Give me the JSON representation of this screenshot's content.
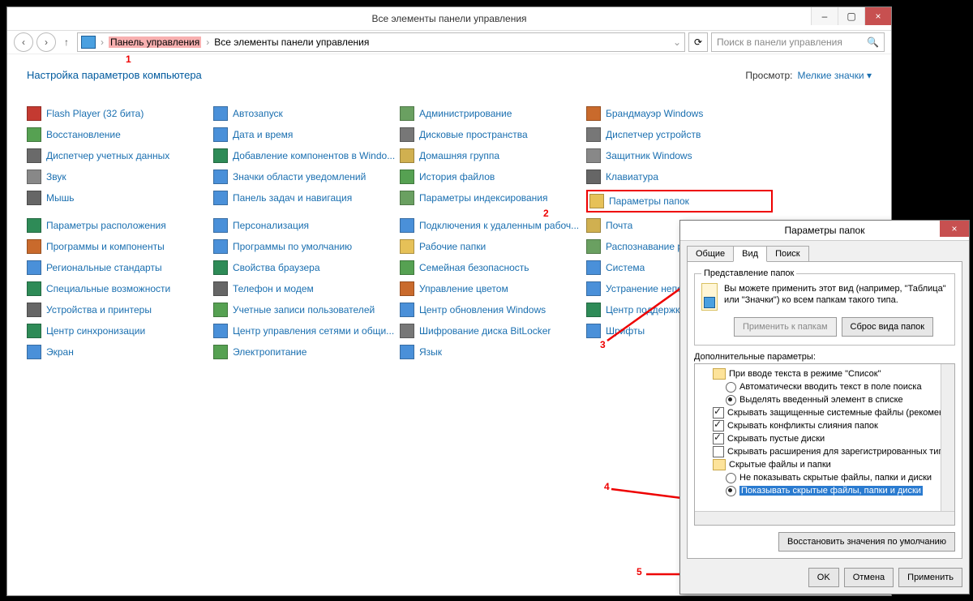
{
  "window": {
    "title": "Все элементы панели управления",
    "minimize": "–",
    "maximize": "▢",
    "close": "×"
  },
  "nav": {
    "back": "‹",
    "forward": "›",
    "up": "↑",
    "bc1": "Панель управления",
    "bc2": "Все элементы панели управления",
    "refresh": "⟳",
    "search_ph": "Поиск в панели управления",
    "mag": "🔍"
  },
  "header": {
    "h": "Настройка параметров компьютера",
    "view_label": "Просмотр:",
    "view_value": "Мелкие значки ▾"
  },
  "items": [
    {
      "t": "Flash Player (32 бита)",
      "c": "#c43a31",
      "hl": false
    },
    {
      "t": "Автозапуск",
      "c": "#4a90d9",
      "hl": false
    },
    {
      "t": "Администрирование",
      "c": "#6aa061",
      "hl": false
    },
    {
      "t": "Брандмауэр Windows",
      "c": "#c96a2c",
      "hl": false
    },
    {
      "t": "Восстановление",
      "c": "#56a152",
      "hl": false
    },
    {
      "t": "Дата и время",
      "c": "#4a90d9",
      "hl": false
    },
    {
      "t": "Дисковые пространства",
      "c": "#777",
      "hl": false
    },
    {
      "t": "Диспетчер устройств",
      "c": "#777",
      "hl": false
    },
    {
      "t": "Диспетчер учетных данных",
      "c": "#6a6a6a",
      "hl": false
    },
    {
      "t": "Добавление компонентов в Windo...",
      "c": "#2e8b57",
      "hl": false
    },
    {
      "t": "Домашняя группа",
      "c": "#d0b050",
      "hl": false
    },
    {
      "t": "Защитник Windows",
      "c": "#888",
      "hl": false
    },
    {
      "t": "Звук",
      "c": "#888",
      "hl": false
    },
    {
      "t": "Значки области уведомлений",
      "c": "#4a90d9",
      "hl": false
    },
    {
      "t": "История файлов",
      "c": "#56a152",
      "hl": false
    },
    {
      "t": "Клавиатура",
      "c": "#666",
      "hl": false
    },
    {
      "t": "Мышь",
      "c": "#666",
      "hl": false
    },
    {
      "t": "Панель задач и навигация",
      "c": "#4a90d9",
      "hl": false
    },
    {
      "t": "Параметры индексирования",
      "c": "#6aa061",
      "hl": false
    },
    {
      "t": "Параметры папок",
      "c": "#e6c158",
      "hl": true
    },
    {
      "t": "Параметры расположения",
      "c": "#2e8b57",
      "hl": false
    },
    {
      "t": "Персонализация",
      "c": "#4a90d9",
      "hl": false
    },
    {
      "t": "Подключения к удаленным рабоч...",
      "c": "#4a90d9",
      "hl": false
    },
    {
      "t": "Почта",
      "c": "#d0b050",
      "hl": false
    },
    {
      "t": "Программы и компоненты",
      "c": "#c96a2c",
      "hl": false
    },
    {
      "t": "Программы по умолчанию",
      "c": "#4a90d9",
      "hl": false
    },
    {
      "t": "Рабочие папки",
      "c": "#e6c158",
      "hl": false
    },
    {
      "t": "Распознавание речи",
      "c": "#6aa061",
      "hl": false
    },
    {
      "t": "Региональные стандарты",
      "c": "#4a90d9",
      "hl": false
    },
    {
      "t": "Свойства браузера",
      "c": "#2e8b57",
      "hl": false
    },
    {
      "t": "Семейная безопасность",
      "c": "#56a152",
      "hl": false
    },
    {
      "t": "Система",
      "c": "#4a90d9",
      "hl": false
    },
    {
      "t": "Специальные возможности",
      "c": "#2e8b57",
      "hl": false
    },
    {
      "t": "Телефон и модем",
      "c": "#666",
      "hl": false
    },
    {
      "t": "Управление цветом",
      "c": "#c96a2c",
      "hl": false
    },
    {
      "t": "Устранение неполадок",
      "c": "#4a90d9",
      "hl": false
    },
    {
      "t": "Устройства и принтеры",
      "c": "#666",
      "hl": false
    },
    {
      "t": "Учетные записи пользователей",
      "c": "#56a152",
      "hl": false
    },
    {
      "t": "Центр обновления Windows",
      "c": "#4a90d9",
      "hl": false
    },
    {
      "t": "Центр поддержки",
      "c": "#2e8b57",
      "hl": false
    },
    {
      "t": "Центр синхронизации",
      "c": "#2e8b57",
      "hl": false
    },
    {
      "t": "Центр управления сетями и общи...",
      "c": "#4a90d9",
      "hl": false
    },
    {
      "t": "Шифрование диска BitLocker",
      "c": "#777",
      "hl": false
    },
    {
      "t": "Шрифты",
      "c": "#4a90d9",
      "hl": false
    },
    {
      "t": "Экран",
      "c": "#4a90d9",
      "hl": false
    },
    {
      "t": "Электропитание",
      "c": "#56a152",
      "hl": false
    },
    {
      "t": "Язык",
      "c": "#4a90d9",
      "hl": false
    }
  ],
  "dlg": {
    "title": "Параметры папок",
    "close": "×",
    "tabs": {
      "general": "Общие",
      "view": "Вид",
      "search": "Поиск"
    },
    "fv_legend": "Представление папок",
    "fv_text": "Вы можете применить этот вид (например, \"Таблица\" или \"Значки\") ко всем папкам такого типа.",
    "btn_apply_folders": "Применить к папкам",
    "btn_reset_folders": "Сброс вида папок",
    "adv_label": "Дополнительные параметры:",
    "tree": {
      "n0": "При вводе текста в режиме \"Список\"",
      "r0a": "Автоматически вводить текст в поле поиска",
      "r0b": "Выделять введенный элемент в списке",
      "c1": "Скрывать защищенные системные файлы (рекомен.",
      "c2": "Скрывать конфликты слияния папок",
      "c3": "Скрывать пустые диски",
      "c4": "Скрывать расширения для зарегистрированных типо",
      "n1": "Скрытые файлы и папки",
      "r1a": "Не показывать скрытые файлы, папки и диски",
      "r1b": "Показывать скрытые файлы, папки и диски"
    },
    "btn_restore": "Восстановить значения по умолчанию",
    "btn_ok": "OK",
    "btn_cancel": "Отмена",
    "btn_apply": "Применить"
  },
  "ann": {
    "a1": "1",
    "a2": "2",
    "a3": "3",
    "a4": "4",
    "a5": "5"
  }
}
